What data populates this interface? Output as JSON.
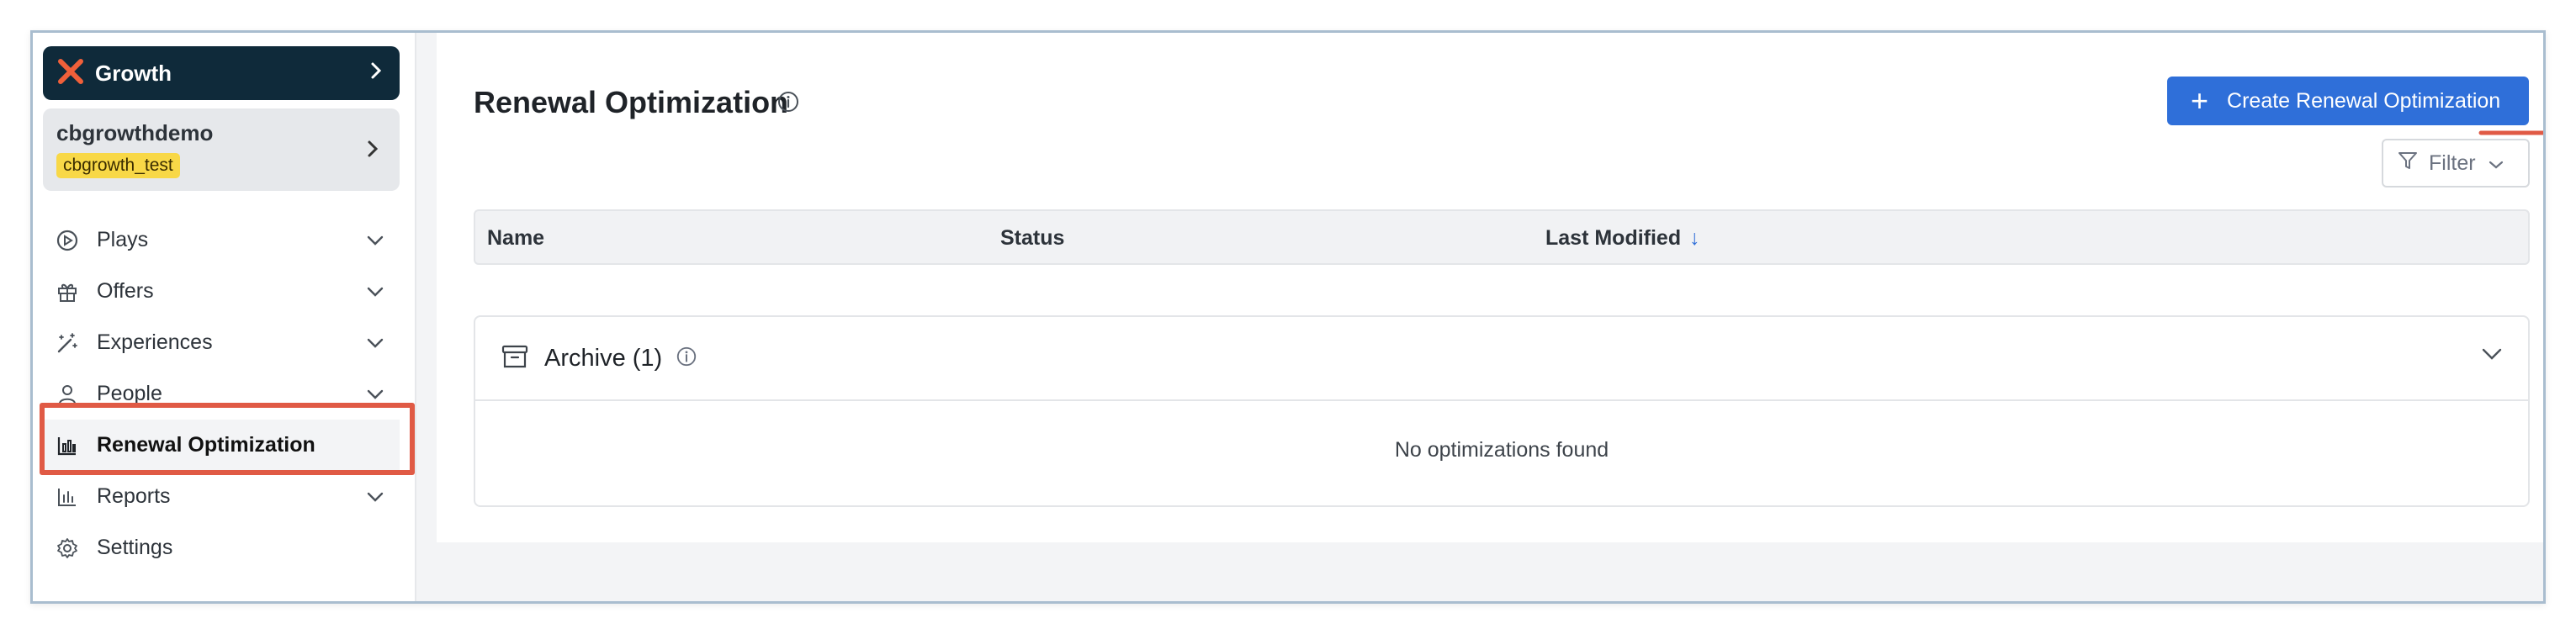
{
  "workspace": {
    "name": "Growth"
  },
  "site": {
    "name": "cbgrowthdemo",
    "badge": "cbgrowth_test"
  },
  "nav": {
    "plays": "Plays",
    "offers": "Offers",
    "experiences": "Experiences",
    "people": "People",
    "renewal": "Renewal Optimization",
    "reports": "Reports",
    "settings": "Settings"
  },
  "page": {
    "title": "Renewal Optimization"
  },
  "toolbar": {
    "create_label": "Create Renewal Optimization",
    "filter_label": "Filter"
  },
  "table": {
    "columns": [
      "Name",
      "Status",
      "Last Modified"
    ]
  },
  "archive": {
    "title": "Archive (1)",
    "empty": "No optimizations found"
  },
  "colors": {
    "accent": "#2f6fd9",
    "sidebar_dark": "#0f2a3a",
    "highlight": "#e05a45",
    "badge": "#f8d847"
  }
}
